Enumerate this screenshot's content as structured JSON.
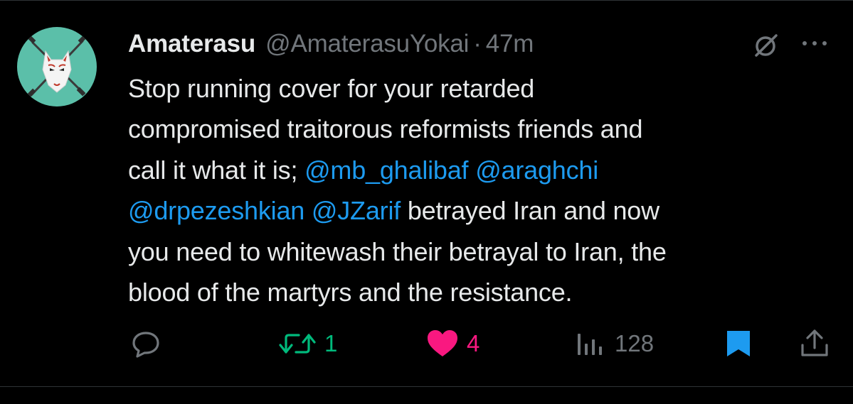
{
  "tweet": {
    "author_name": "Amaterasu",
    "handle": "@AmaterasuYokai",
    "separator": "·",
    "time": "47m",
    "lines": [
      [
        {
          "text": "Stop running cover for your retarded",
          "mention": false
        }
      ],
      [
        {
          "text": "compromised traitorous reformists friends and",
          "mention": false
        }
      ],
      [
        {
          "text": "call it what it is; ",
          "mention": false
        },
        {
          "text": "@mb_ghalibaf",
          "mention": true
        },
        {
          "text": " ",
          "mention": false
        },
        {
          "text": "@araghchi",
          "mention": true
        }
      ],
      [
        {
          "text": "@drpezeshkian",
          "mention": true
        },
        {
          "text": " ",
          "mention": false
        },
        {
          "text": "@JZarif",
          "mention": true
        },
        {
          "text": " betrayed Iran and now",
          "mention": false
        }
      ],
      [
        {
          "text": "you need to whitewash their betrayal to Iran, the",
          "mention": false
        }
      ],
      [
        {
          "text": "blood of the martyrs and the resistance.",
          "mention": false
        }
      ]
    ]
  },
  "actions": {
    "retweets": "1",
    "likes": "4",
    "views": "128"
  },
  "icons": {
    "avatar": "kitsune-mask-avatar",
    "grok": "grok-icon",
    "more": "more-icon",
    "reply": "reply-icon",
    "retweet": "retweet-icon",
    "like": "heart-icon",
    "views": "views-icon",
    "bookmark": "bookmark-icon",
    "share": "share-icon"
  },
  "colors": {
    "background": "#000000",
    "text": "#e7e9ea",
    "muted": "#71767b",
    "mention": "#1d9bf0",
    "retweeted": "#00ba7c",
    "liked": "#f91880",
    "bookmarked": "#1d9bf0",
    "avatar_bg": "#5bbfa9"
  }
}
